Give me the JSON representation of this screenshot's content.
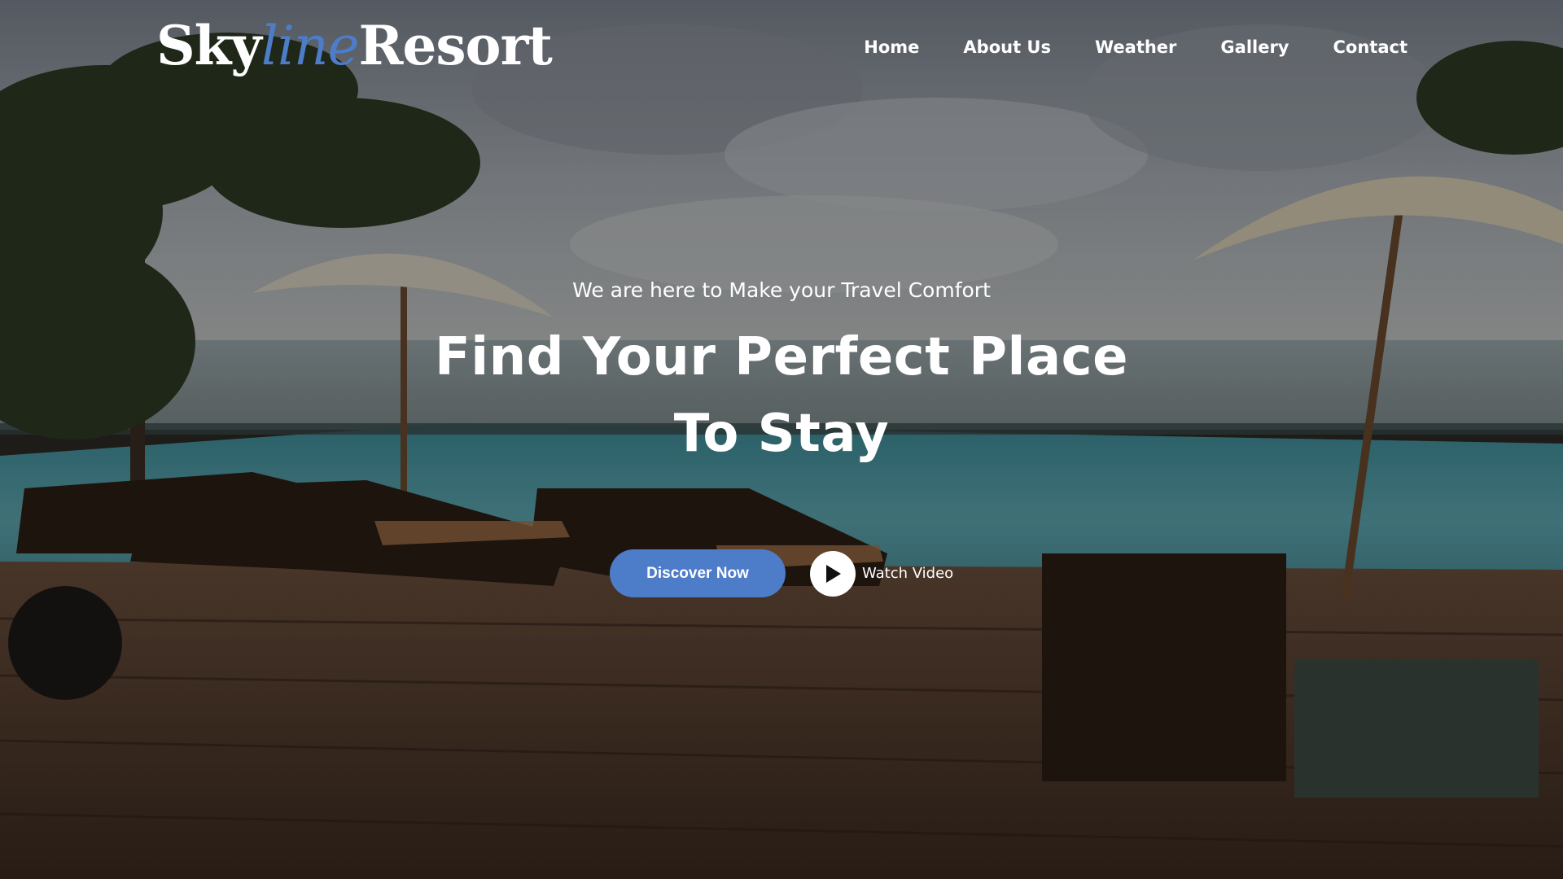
{
  "brand": {
    "part1": "Sky",
    "part2": "line",
    "part3": "Resort"
  },
  "nav": {
    "items": [
      {
        "label": "Home"
      },
      {
        "label": "About Us"
      },
      {
        "label": "Weather"
      },
      {
        "label": "Gallery"
      },
      {
        "label": "Contact"
      }
    ]
  },
  "hero": {
    "tagline": "We are here to Make your Travel Comfort",
    "headline_line1": "Find Your Perfect Place",
    "headline_line2": "To Stay",
    "primary_button": "Discover Now",
    "video_link": "Watch Video",
    "video_icon": "play-icon",
    "background": "resort-poolside-background-photo"
  },
  "colors": {
    "accent": "#4d7cc9",
    "text": "#ffffff"
  }
}
